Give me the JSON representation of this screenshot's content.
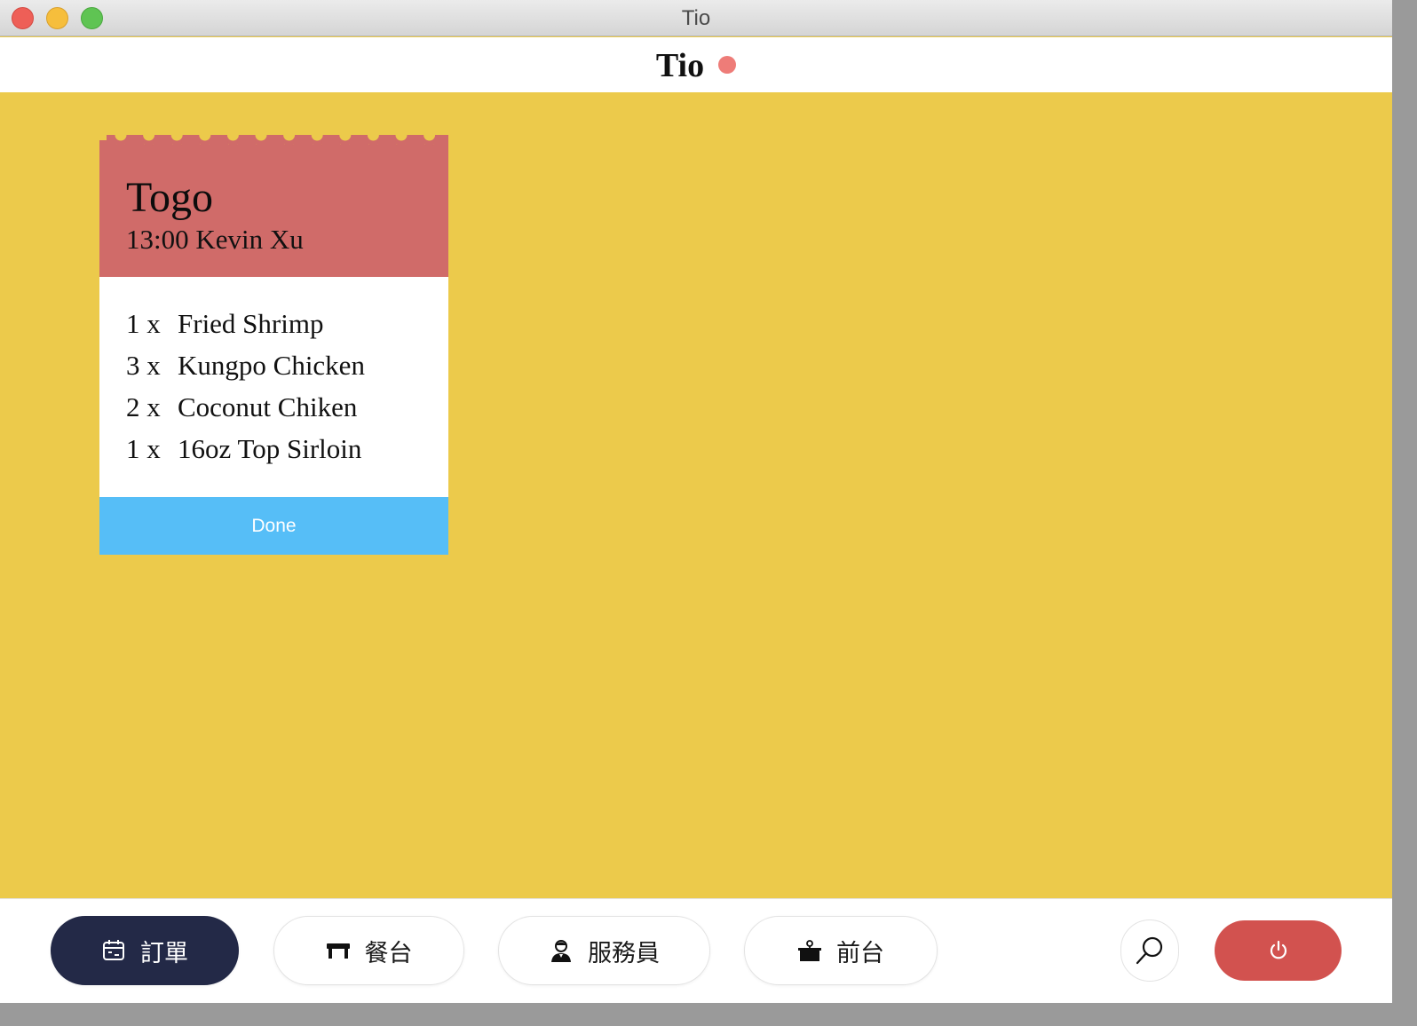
{
  "window": {
    "title": "Tio"
  },
  "header": {
    "app_name": "Tio",
    "status_color": "#ee7c78"
  },
  "ticket": {
    "type": "Togo",
    "meta": "13:00 Kevin Xu",
    "items": [
      {
        "qty": "1 x",
        "name": "Fried Shrimp"
      },
      {
        "qty": "3 x",
        "name": "Kungpo Chicken"
      },
      {
        "qty": "2 x",
        "name": "Coconut Chiken"
      },
      {
        "qty": "1 x",
        "name": "16oz Top Sirloin"
      }
    ],
    "done_label": "Done"
  },
  "toolbar": {
    "nav": [
      {
        "label": "訂單",
        "icon": "calendar-icon",
        "active": true
      },
      {
        "label": "餐台",
        "icon": "table-icon",
        "active": false
      },
      {
        "label": "服務員",
        "icon": "waiter-icon",
        "active": false
      },
      {
        "label": "前台",
        "icon": "front-desk-icon",
        "active": false
      }
    ],
    "search_icon": "search-icon",
    "power_icon": "power-icon"
  },
  "colors": {
    "background": "#ecca4b",
    "ticket_header": "#d06b69",
    "done_button": "#56bef7",
    "active_nav": "#232947",
    "power_button": "#d2524f"
  }
}
